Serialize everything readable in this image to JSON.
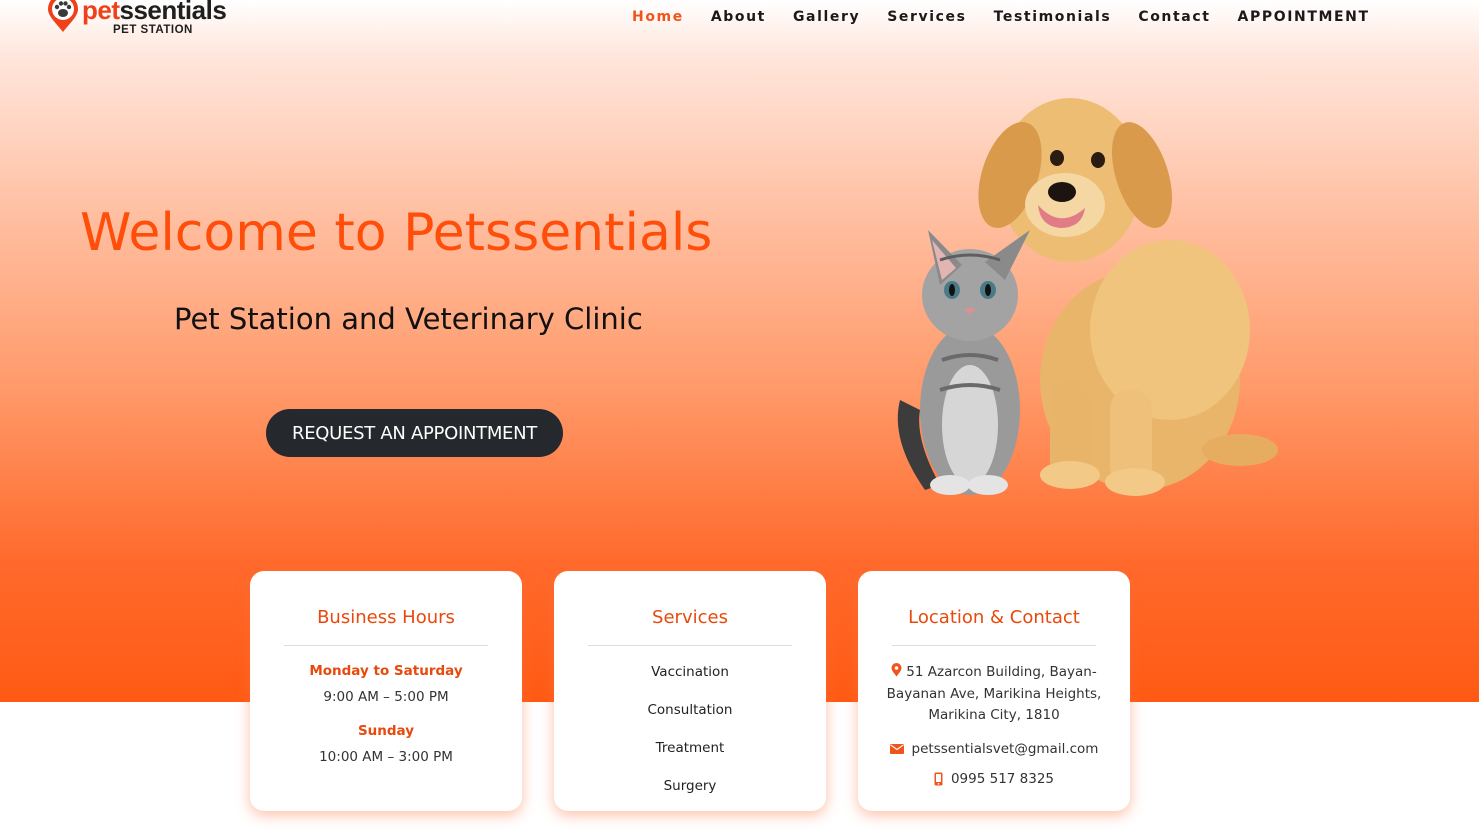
{
  "logo": {
    "brand_prefix": "pet",
    "brand_suffix": "ssentials",
    "tagline": "PET STATION",
    "icon": "paw-pin-icon"
  },
  "nav": {
    "items": [
      {
        "label": "Home",
        "active": true
      },
      {
        "label": "About"
      },
      {
        "label": "Gallery"
      },
      {
        "label": "Services"
      },
      {
        "label": "Testimonials"
      },
      {
        "label": "Contact"
      },
      {
        "label": "APPOINTMENT"
      }
    ]
  },
  "hero": {
    "title": "Welcome to Petssentials",
    "subtitle": "Pet Station and Veterinary Clinic",
    "cta_label": "REQUEST AN APPOINTMENT",
    "image": "cat-and-puppy-illustration"
  },
  "cards": {
    "hours": {
      "title": "Business Hours",
      "weekday_label": "Monday to Saturday",
      "weekday_hours": "9:00 AM – 5:00 PM",
      "sunday_label": "Sunday",
      "sunday_hours": "10:00 AM – 3:00 PM"
    },
    "services": {
      "title": "Services",
      "items": [
        "Vaccination",
        "Consultation",
        "Treatment",
        "Surgery"
      ]
    },
    "contact": {
      "title": "Location & Contact",
      "address": "51 Azarcon Building, Bayan-Bayanan Ave, Marikina Heights, Marikina City, 1810",
      "email": "petssentialsvet@gmail.com",
      "phone": "0995 517 8325",
      "address_icon": "map-pin-icon",
      "email_icon": "envelope-icon",
      "phone_icon": "mobile-phone-icon"
    }
  },
  "colors": {
    "accent": "#f0541a",
    "button_bg": "#25282c",
    "hero_bottom": "#ff5a14"
  }
}
